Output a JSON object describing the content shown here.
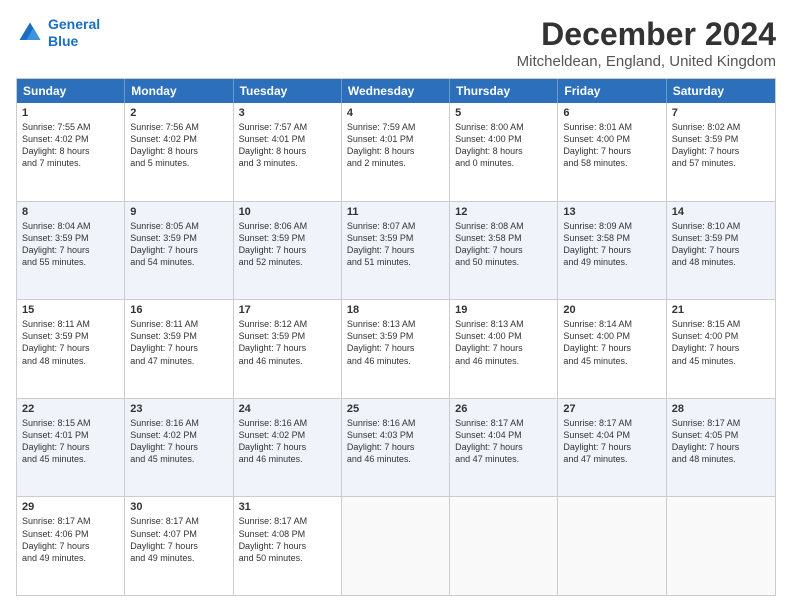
{
  "header": {
    "logo_line1": "General",
    "logo_line2": "Blue",
    "main_title": "December 2024",
    "subtitle": "Mitcheldean, England, United Kingdom"
  },
  "weekdays": [
    "Sunday",
    "Monday",
    "Tuesday",
    "Wednesday",
    "Thursday",
    "Friday",
    "Saturday"
  ],
  "rows": [
    [
      {
        "day": "1",
        "lines": [
          "Sunrise: 7:55 AM",
          "Sunset: 4:02 PM",
          "Daylight: 8 hours",
          "and 7 minutes."
        ],
        "shaded": false
      },
      {
        "day": "2",
        "lines": [
          "Sunrise: 7:56 AM",
          "Sunset: 4:02 PM",
          "Daylight: 8 hours",
          "and 5 minutes."
        ],
        "shaded": false
      },
      {
        "day": "3",
        "lines": [
          "Sunrise: 7:57 AM",
          "Sunset: 4:01 PM",
          "Daylight: 8 hours",
          "and 3 minutes."
        ],
        "shaded": false
      },
      {
        "day": "4",
        "lines": [
          "Sunrise: 7:59 AM",
          "Sunset: 4:01 PM",
          "Daylight: 8 hours",
          "and 2 minutes."
        ],
        "shaded": false
      },
      {
        "day": "5",
        "lines": [
          "Sunrise: 8:00 AM",
          "Sunset: 4:00 PM",
          "Daylight: 8 hours",
          "and 0 minutes."
        ],
        "shaded": false
      },
      {
        "day": "6",
        "lines": [
          "Sunrise: 8:01 AM",
          "Sunset: 4:00 PM",
          "Daylight: 7 hours",
          "and 58 minutes."
        ],
        "shaded": false
      },
      {
        "day": "7",
        "lines": [
          "Sunrise: 8:02 AM",
          "Sunset: 3:59 PM",
          "Daylight: 7 hours",
          "and 57 minutes."
        ],
        "shaded": false
      }
    ],
    [
      {
        "day": "8",
        "lines": [
          "Sunrise: 8:04 AM",
          "Sunset: 3:59 PM",
          "Daylight: 7 hours",
          "and 55 minutes."
        ],
        "shaded": true
      },
      {
        "day": "9",
        "lines": [
          "Sunrise: 8:05 AM",
          "Sunset: 3:59 PM",
          "Daylight: 7 hours",
          "and 54 minutes."
        ],
        "shaded": true
      },
      {
        "day": "10",
        "lines": [
          "Sunrise: 8:06 AM",
          "Sunset: 3:59 PM",
          "Daylight: 7 hours",
          "and 52 minutes."
        ],
        "shaded": true
      },
      {
        "day": "11",
        "lines": [
          "Sunrise: 8:07 AM",
          "Sunset: 3:59 PM",
          "Daylight: 7 hours",
          "and 51 minutes."
        ],
        "shaded": true
      },
      {
        "day": "12",
        "lines": [
          "Sunrise: 8:08 AM",
          "Sunset: 3:58 PM",
          "Daylight: 7 hours",
          "and 50 minutes."
        ],
        "shaded": true
      },
      {
        "day": "13",
        "lines": [
          "Sunrise: 8:09 AM",
          "Sunset: 3:58 PM",
          "Daylight: 7 hours",
          "and 49 minutes."
        ],
        "shaded": true
      },
      {
        "day": "14",
        "lines": [
          "Sunrise: 8:10 AM",
          "Sunset: 3:59 PM",
          "Daylight: 7 hours",
          "and 48 minutes."
        ],
        "shaded": true
      }
    ],
    [
      {
        "day": "15",
        "lines": [
          "Sunrise: 8:11 AM",
          "Sunset: 3:59 PM",
          "Daylight: 7 hours",
          "and 48 minutes."
        ],
        "shaded": false
      },
      {
        "day": "16",
        "lines": [
          "Sunrise: 8:11 AM",
          "Sunset: 3:59 PM",
          "Daylight: 7 hours",
          "and 47 minutes."
        ],
        "shaded": false
      },
      {
        "day": "17",
        "lines": [
          "Sunrise: 8:12 AM",
          "Sunset: 3:59 PM",
          "Daylight: 7 hours",
          "and 46 minutes."
        ],
        "shaded": false
      },
      {
        "day": "18",
        "lines": [
          "Sunrise: 8:13 AM",
          "Sunset: 3:59 PM",
          "Daylight: 7 hours",
          "and 46 minutes."
        ],
        "shaded": false
      },
      {
        "day": "19",
        "lines": [
          "Sunrise: 8:13 AM",
          "Sunset: 4:00 PM",
          "Daylight: 7 hours",
          "and 46 minutes."
        ],
        "shaded": false
      },
      {
        "day": "20",
        "lines": [
          "Sunrise: 8:14 AM",
          "Sunset: 4:00 PM",
          "Daylight: 7 hours",
          "and 45 minutes."
        ],
        "shaded": false
      },
      {
        "day": "21",
        "lines": [
          "Sunrise: 8:15 AM",
          "Sunset: 4:00 PM",
          "Daylight: 7 hours",
          "and 45 minutes."
        ],
        "shaded": false
      }
    ],
    [
      {
        "day": "22",
        "lines": [
          "Sunrise: 8:15 AM",
          "Sunset: 4:01 PM",
          "Daylight: 7 hours",
          "and 45 minutes."
        ],
        "shaded": true
      },
      {
        "day": "23",
        "lines": [
          "Sunrise: 8:16 AM",
          "Sunset: 4:02 PM",
          "Daylight: 7 hours",
          "and 45 minutes."
        ],
        "shaded": true
      },
      {
        "day": "24",
        "lines": [
          "Sunrise: 8:16 AM",
          "Sunset: 4:02 PM",
          "Daylight: 7 hours",
          "and 46 minutes."
        ],
        "shaded": true
      },
      {
        "day": "25",
        "lines": [
          "Sunrise: 8:16 AM",
          "Sunset: 4:03 PM",
          "Daylight: 7 hours",
          "and 46 minutes."
        ],
        "shaded": true
      },
      {
        "day": "26",
        "lines": [
          "Sunrise: 8:17 AM",
          "Sunset: 4:04 PM",
          "Daylight: 7 hours",
          "and 47 minutes."
        ],
        "shaded": true
      },
      {
        "day": "27",
        "lines": [
          "Sunrise: 8:17 AM",
          "Sunset: 4:04 PM",
          "Daylight: 7 hours",
          "and 47 minutes."
        ],
        "shaded": true
      },
      {
        "day": "28",
        "lines": [
          "Sunrise: 8:17 AM",
          "Sunset: 4:05 PM",
          "Daylight: 7 hours",
          "and 48 minutes."
        ],
        "shaded": true
      }
    ],
    [
      {
        "day": "29",
        "lines": [
          "Sunrise: 8:17 AM",
          "Sunset: 4:06 PM",
          "Daylight: 7 hours",
          "and 49 minutes."
        ],
        "shaded": false
      },
      {
        "day": "30",
        "lines": [
          "Sunrise: 8:17 AM",
          "Sunset: 4:07 PM",
          "Daylight: 7 hours",
          "and 49 minutes."
        ],
        "shaded": false
      },
      {
        "day": "31",
        "lines": [
          "Sunrise: 8:17 AM",
          "Sunset: 4:08 PM",
          "Daylight: 7 hours",
          "and 50 minutes."
        ],
        "shaded": false
      },
      {
        "day": "",
        "lines": [],
        "shaded": false,
        "empty": true
      },
      {
        "day": "",
        "lines": [],
        "shaded": false,
        "empty": true
      },
      {
        "day": "",
        "lines": [],
        "shaded": false,
        "empty": true
      },
      {
        "day": "",
        "lines": [],
        "shaded": false,
        "empty": true
      }
    ]
  ]
}
